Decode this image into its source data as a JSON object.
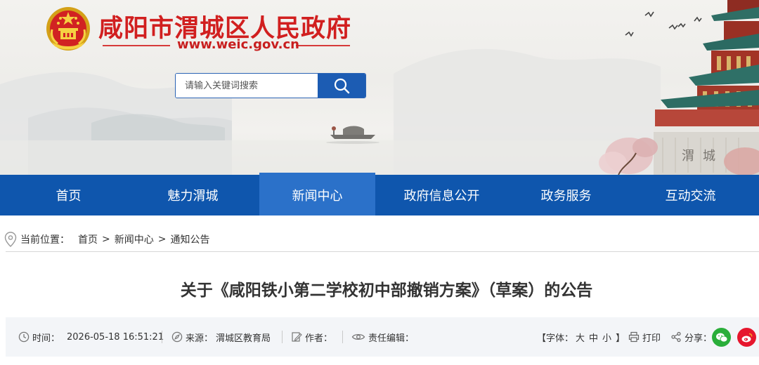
{
  "header": {
    "site_title": "咸阳市渭城区人民政府",
    "site_url": "www.weic.gov.cn"
  },
  "search": {
    "placeholder": "请输入关键词搜索",
    "value": ""
  },
  "nav": {
    "items": [
      {
        "label": "首页"
      },
      {
        "label": "魅力渭城"
      },
      {
        "label": "新闻中心"
      },
      {
        "label": "政府信息公开"
      },
      {
        "label": "政务服务"
      },
      {
        "label": "互动交流"
      }
    ],
    "active": "新闻中心"
  },
  "breadcrumb": {
    "label": "当前位置：",
    "items": [
      "首页",
      "新闻中心",
      "通知公告"
    ],
    "separator": ">"
  },
  "article": {
    "title": "关于《咸阳铁小第二学校初中部撤销方案》（草案）的公告"
  },
  "meta": {
    "time_label": "时间：",
    "time_value": "2026-05-18 16:51:21",
    "source_label": "来源：",
    "source_value": "渭城区教育局",
    "author_label": "作者：",
    "author_value": "",
    "editor_label": "责任编辑：",
    "editor_value": "",
    "font_open": "【字体：",
    "font_large": "大",
    "font_medium": "中",
    "font_small": "小",
    "font_close": "】",
    "print_label": "打印",
    "share_label": "分享："
  },
  "colors": {
    "nav_bg": "#0f56ad",
    "nav_active_bg": "#2b71c9",
    "title_red": "#d11f1f",
    "wechat_green": "#2aae3a",
    "weibo_red": "#e6162d",
    "meta_bg": "#f3f5f8"
  },
  "icons": [
    "national-emblem",
    "search-icon",
    "location-pin-icon",
    "clock-icon",
    "compass-icon",
    "edit-icon",
    "eye-icon",
    "printer-icon",
    "share-icon",
    "wechat-icon",
    "weibo-icon"
  ]
}
